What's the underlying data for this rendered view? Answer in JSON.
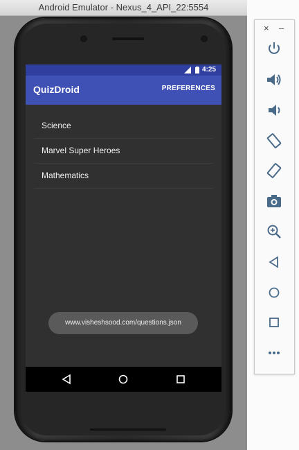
{
  "window": {
    "title": "Android Emulator - Nexus_4_API_22:5554"
  },
  "phone": {
    "status_bar": {
      "time": "4:25"
    },
    "app_bar": {
      "title": "QuizDroid",
      "action_label": "PREFERENCES"
    },
    "topics": [
      {
        "label": "Science"
      },
      {
        "label": "Marvel Super Heroes"
      },
      {
        "label": "Mathematics"
      }
    ],
    "toast": {
      "text": "www.visheshsood.com/questions.json"
    },
    "nav": {
      "back_icon": "back-triangle-icon",
      "home_icon": "home-circle-icon",
      "recents_icon": "recents-square-icon"
    }
  },
  "toolbar": {
    "close_label": "×",
    "minimize_label": "–",
    "buttons": [
      {
        "icon": "power-icon"
      },
      {
        "icon": "volume-up-icon"
      },
      {
        "icon": "volume-down-icon"
      },
      {
        "icon": "rotate-left-icon"
      },
      {
        "icon": "rotate-right-icon"
      },
      {
        "icon": "camera-icon"
      },
      {
        "icon": "zoom-icon"
      },
      {
        "icon": "back-icon"
      },
      {
        "icon": "home-icon"
      },
      {
        "icon": "overview-icon"
      },
      {
        "icon": "more-icon"
      }
    ]
  },
  "colors": {
    "primary": "#3f51b5",
    "primary_dark": "#303f9f",
    "screen_bg": "#303030"
  }
}
